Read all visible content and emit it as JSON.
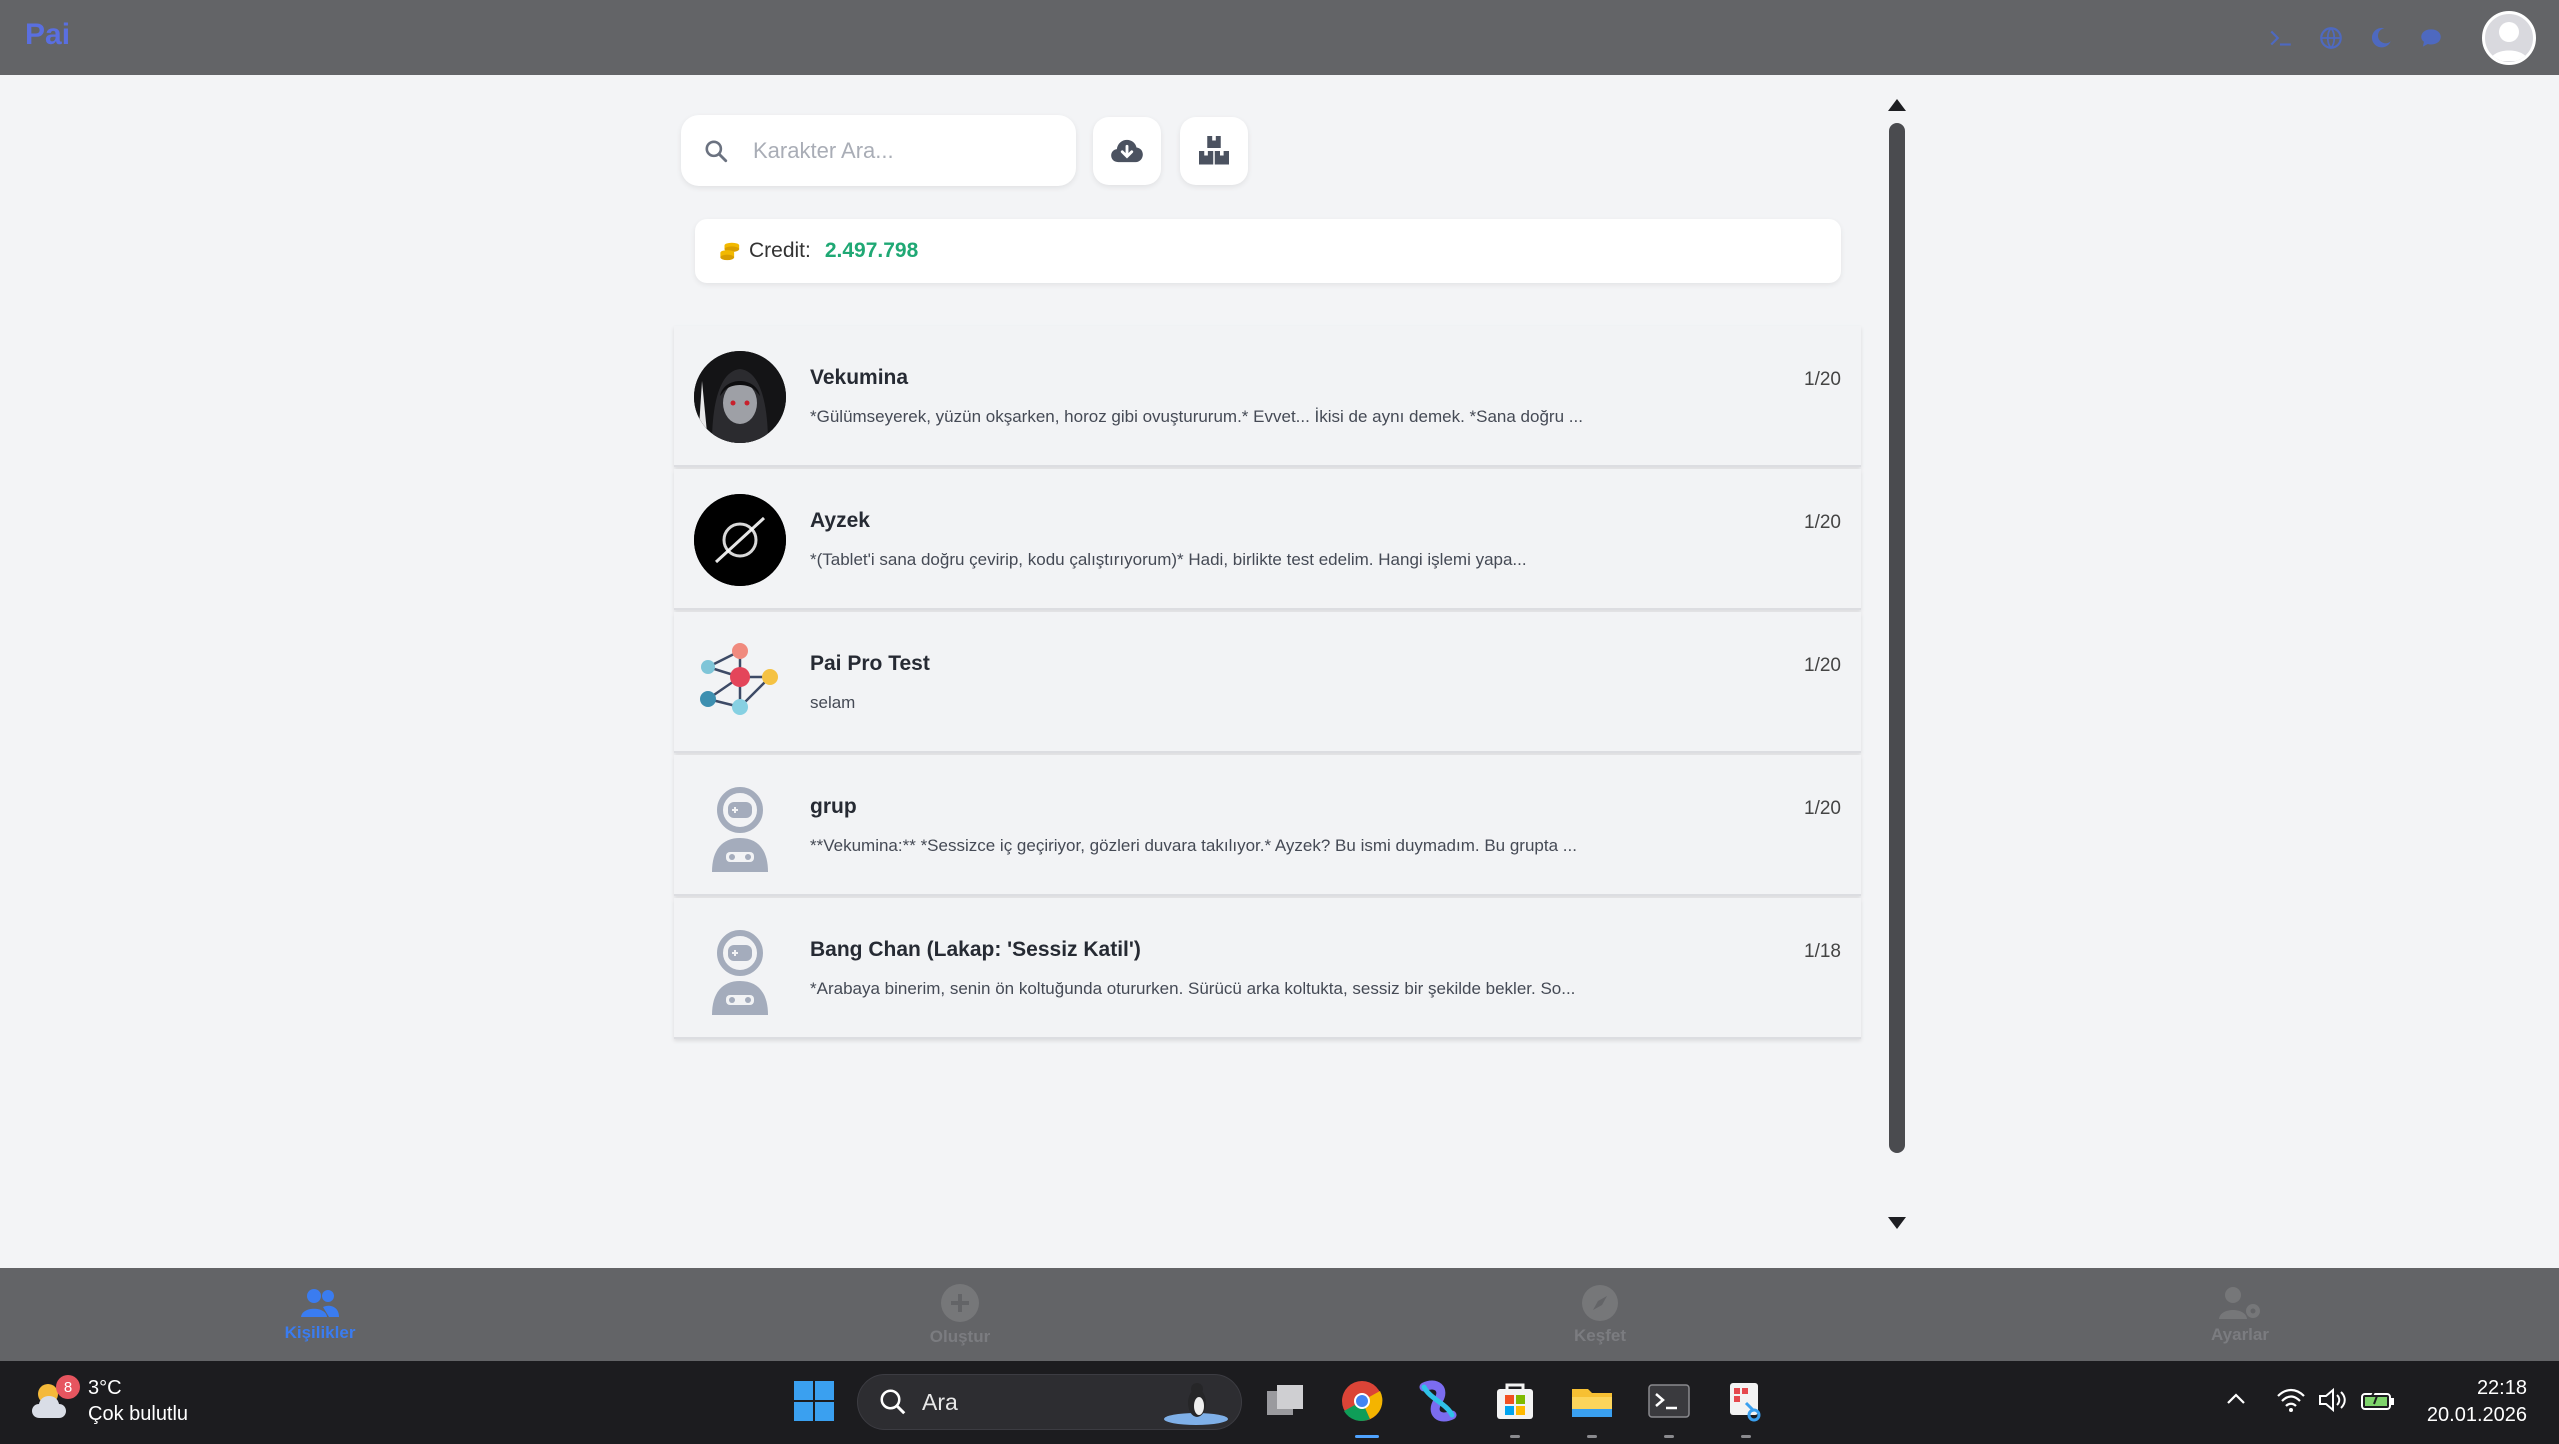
{
  "app": {
    "brand": "Pai"
  },
  "search": {
    "placeholder": "Karakter Ara..."
  },
  "credit": {
    "label": "Credit:",
    "value": "2.497.798"
  },
  "characters": [
    {
      "name": "Vekumina",
      "count": "1/20",
      "message": "*Gülümseyerek, yüzün okşarken, horoz gibi ovuştururum.* Evvet... İkisi de aynı demek. *Sana doğru ..."
    },
    {
      "name": "Ayzek",
      "count": "1/20",
      "message": "*(Tablet'i sana doğru çevirip, kodu çalıştırıyorum)* Hadi, birlikte test edelim. Hangi işlemi yapa..."
    },
    {
      "name": "Pai Pro Test",
      "count": "1/20",
      "message": "selam"
    },
    {
      "name": "grup",
      "count": "1/20",
      "message": "**Vekumina:** *Sessizce iç geçiriyor, gözleri duvara takılıyor.* Ayzek? Bu ismi duymadım. Bu grupta ..."
    },
    {
      "name": "Bang Chan (Lakap: 'Sessiz Katil')",
      "count": "1/18",
      "message": "*Arabaya binerim, senin ön koltuğunda otururken. Sürücü arka koltukta, sessiz bir şekilde bekler. So..."
    }
  ],
  "bottom_nav": [
    {
      "label": "Kişilikler",
      "icon": "users-icon",
      "active": true
    },
    {
      "label": "Oluştur",
      "icon": "plus-circle-icon",
      "active": false
    },
    {
      "label": "Keşfet",
      "icon": "compass-icon",
      "active": false
    },
    {
      "label": "Ayarlar",
      "icon": "user-gear-icon",
      "active": false
    }
  ],
  "taskbar": {
    "weather_badge": "8",
    "temperature": "3°C",
    "condition": "Çok bulutlu",
    "search_label": "Ara",
    "time": "22:18",
    "date": "20.01.2026"
  },
  "colors": {
    "accent": "#3a7cf0",
    "credit": "#1fa874",
    "topbar": "#636467",
    "brand": "#5a6fe0"
  }
}
